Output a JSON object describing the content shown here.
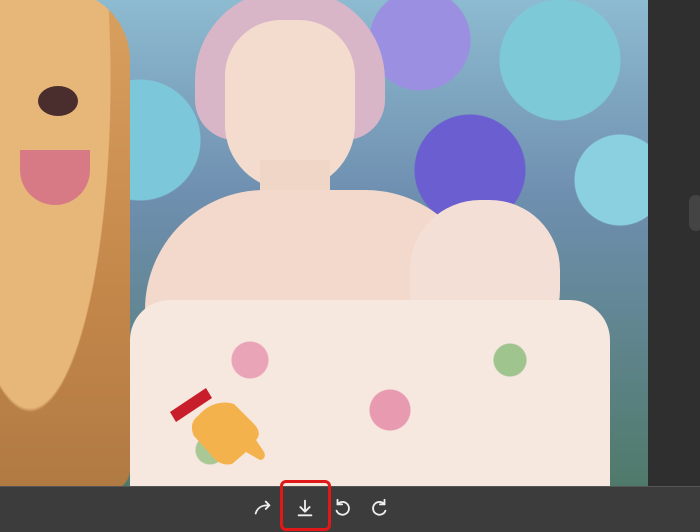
{
  "viewer": {
    "photo_alt": "",
    "highlight_color": "#e01818"
  },
  "toolbar": {
    "icons": [
      "share-icon",
      "download-icon",
      "rotate-left-icon",
      "rotate-right-icon"
    ]
  },
  "overlay": {
    "pointer_icon": "hand-pointing-icon",
    "pointer_color": "#f4b24c"
  }
}
